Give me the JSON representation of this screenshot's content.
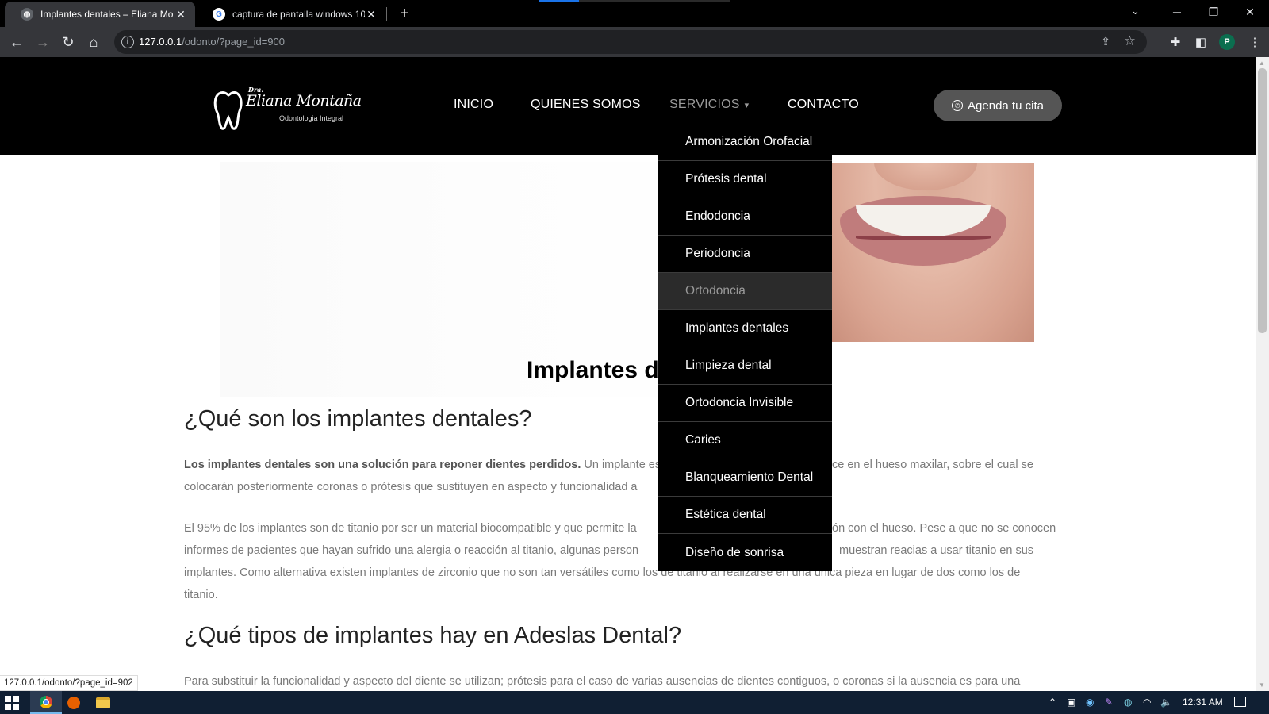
{
  "browser": {
    "tabs": [
      {
        "title": "Implantes dentales – Eliana Mont",
        "active": true
      },
      {
        "title": "captura de pantalla windows 10 -",
        "active": false
      }
    ],
    "url_host": "127.0.0.1",
    "url_path": "/odonto/?page_id=900",
    "profile_initial": "P",
    "status_url": "127.0.0.1/odonto/?page_id=902"
  },
  "site": {
    "logo": {
      "prefix": "Dra.",
      "name": "Eliana Montaña",
      "subtitle": "Odontologia Integral"
    },
    "nav": [
      {
        "label": "INICIO"
      },
      {
        "label": "QUIENES SOMOS"
      },
      {
        "label": "SERVICIOS",
        "has_dropdown": true,
        "expanded": true
      },
      {
        "label": "CONTACTO"
      }
    ],
    "cta_label": "Agenda tu cita",
    "dropdown": [
      "Armonización Orofacial",
      "Prótesis dental",
      "Endodoncia",
      "Periodoncia",
      "Ortodoncia",
      "Implantes dentales",
      "Limpieza dental",
      "Ortodoncia Invisible",
      "Caries",
      "Blanqueamiento Dental",
      "Estética dental",
      "Diseño de sonrisa"
    ],
    "dropdown_hovered": "Ortodoncia"
  },
  "content": {
    "page_title_visible": "Implantes de",
    "h2_1": "¿Qué son los implantes dentales?",
    "p1_bold": "Los implantes dentales son una solución para reponer dientes perdidos.",
    "p1_line1_rest": " Un implante es un",
    "p1_line1_tail": "ce en el hueso maxilar, sobre el cual se",
    "p1_line2": "colocarán posteriormente coronas o prótesis que sustituyen en aspecto y funcionalidad a",
    "p2_line1_a": "El 95% de los implantes son de titanio por ser un material biocompatible y que permite la",
    "p2_line1_b": "ón con el hueso. Pese a que no se conocen",
    "p2_line2_a": "informes de pacientes que hayan sufrido una alergia o reacción al titanio, algunas person",
    "p2_line2_b": "muestran reacias a usar titanio en sus",
    "p2_line3": "implantes. Como alternativa existen implantes de zirconio que no son tan versátiles como los de titanio al realizarse en una única pieza en lugar de dos como los de",
    "p2_line4": "titanio.",
    "h2_2": "¿Qué tipos de implantes hay en Adeslas Dental?",
    "p3_line1": "Para substituir la funcionalidad y aspecto del diente se utilizan; prótesis para el caso de varias ausencias de dientes contiguos, o coronas si la ausencia es para una"
  },
  "taskbar": {
    "time": "12:31 AM"
  }
}
